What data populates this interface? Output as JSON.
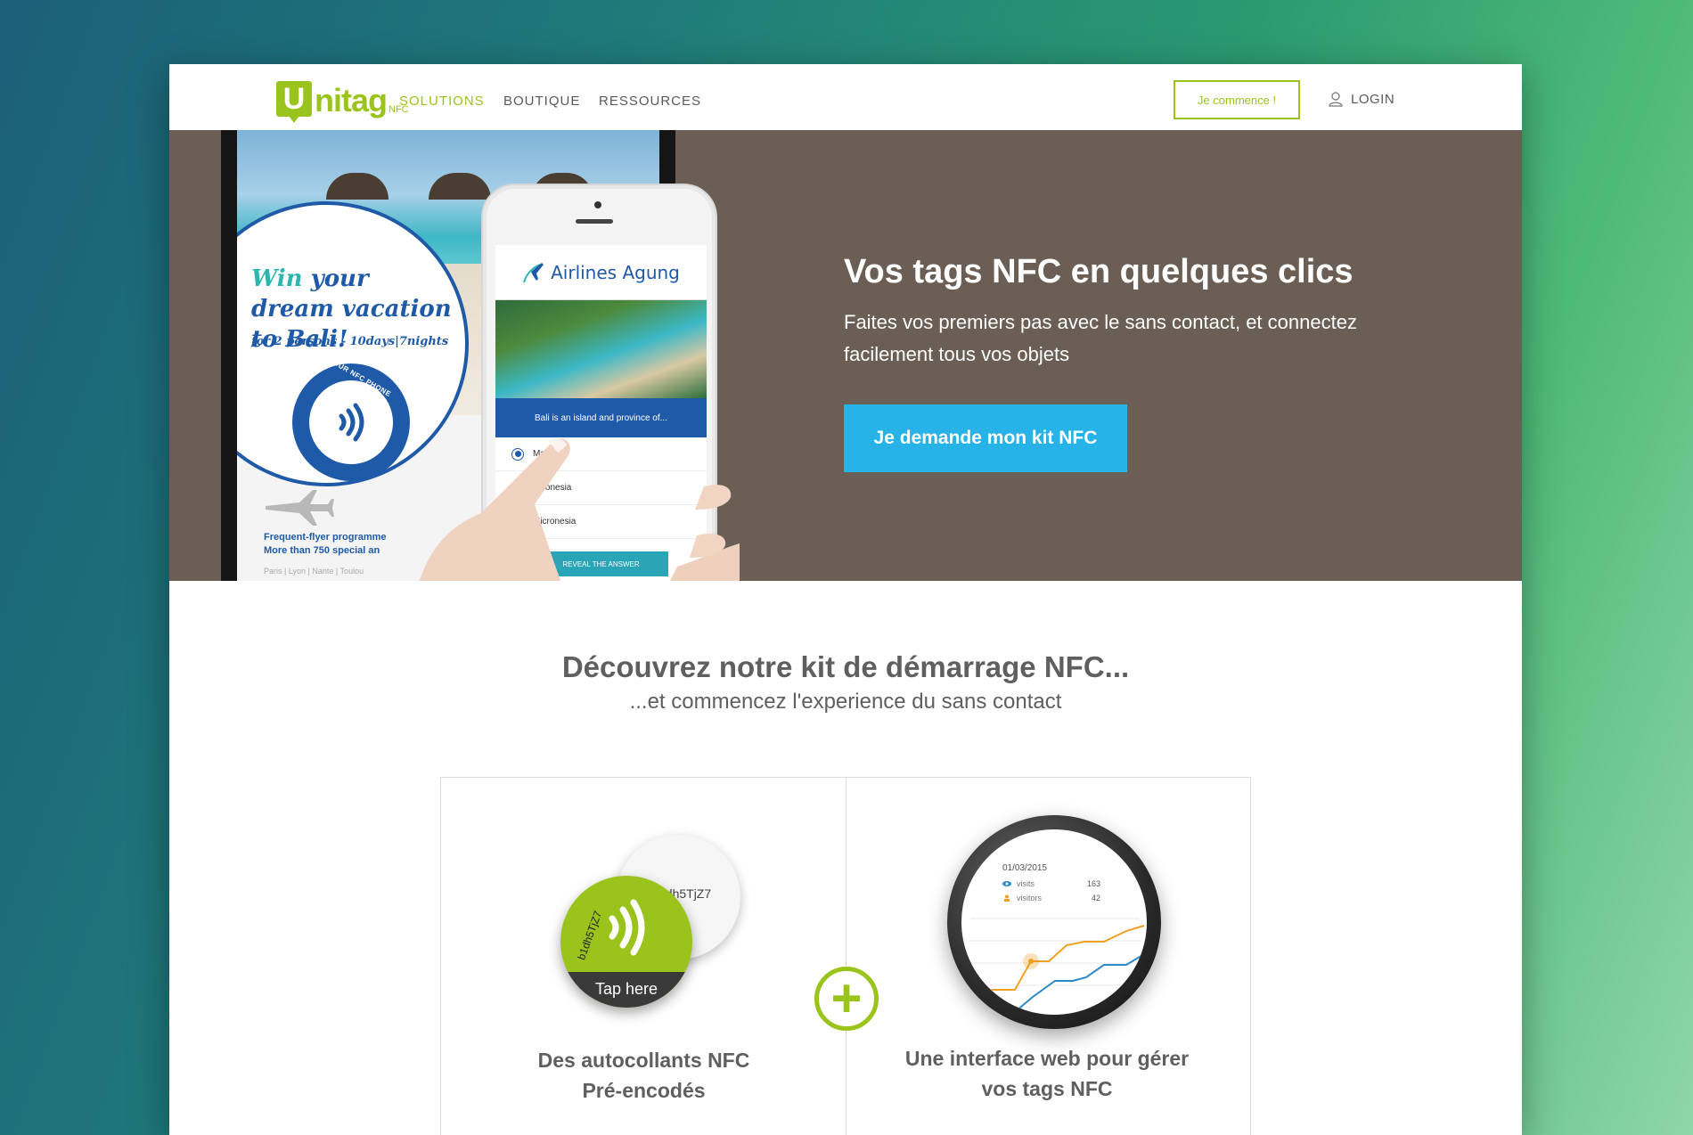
{
  "nav": {
    "logo_letter": "U",
    "logo_text": "nitag",
    "logo_suffix": "NFC",
    "links": [
      {
        "label": "SOLUTIONS",
        "active": true
      },
      {
        "label": "BOUTIQUE",
        "active": false
      },
      {
        "label": "RESSOURCES",
        "active": false
      }
    ],
    "start_button": "Je commence !",
    "login": "LOGIN"
  },
  "hero": {
    "title": "Vos tags NFC en quelques clics",
    "subtitle": "Faites vos premiers pas avec le sans contact, et connectez facilement tous vos objets",
    "cta": "Je demande mon kit NFC",
    "background_color": "#6b5f55",
    "cta_color": "#27b2e8",
    "tablet": {
      "promo_win": "Win",
      "promo_title_rest": "your dream vacation to Bali!",
      "promo_sub": "for 2 persons - 10days|7nights",
      "nfc_label": "TAP YOUR NFC PHONE",
      "ffp_line1": "Frequent-flyer programme",
      "ffp_line2": "More than 750 special an",
      "cities": "Paris | Lyon | Nante | Toulou"
    },
    "phone": {
      "airline": "Airlines Agung",
      "question": "Bali is an island and province of...",
      "options": [
        {
          "label": "Malaysia",
          "selected": true
        },
        {
          "label": "Indonesia",
          "selected": false
        },
        {
          "label": "Micronesia",
          "selected": false
        }
      ],
      "reveal": "REVEAL THE ANSWER"
    }
  },
  "section": {
    "title": "Découvrez notre kit de démarrage NFC...",
    "subtitle": "...et commencez l'experience du sans contact",
    "plus_symbol": "+",
    "features": [
      {
        "line1": "Des autocollants NFC",
        "line2": "Pré-encodés"
      },
      {
        "line1": "Une interface web pour gérer",
        "line2": "vos tags NFC"
      }
    ],
    "sticker": {
      "code_back": "1dh5TjZ7",
      "code_front": "b1dh5TjZ7",
      "tap": "Tap here"
    },
    "watch": {
      "date": "01/03/2015",
      "visits_label": "visits",
      "visits_value": "163",
      "visitors_label": "visitors",
      "visitors_value": "42"
    }
  },
  "colors": {
    "brand_green": "#9ac41b",
    "accent_blue": "#27b2e8",
    "text_gray": "#5f5f5f"
  }
}
